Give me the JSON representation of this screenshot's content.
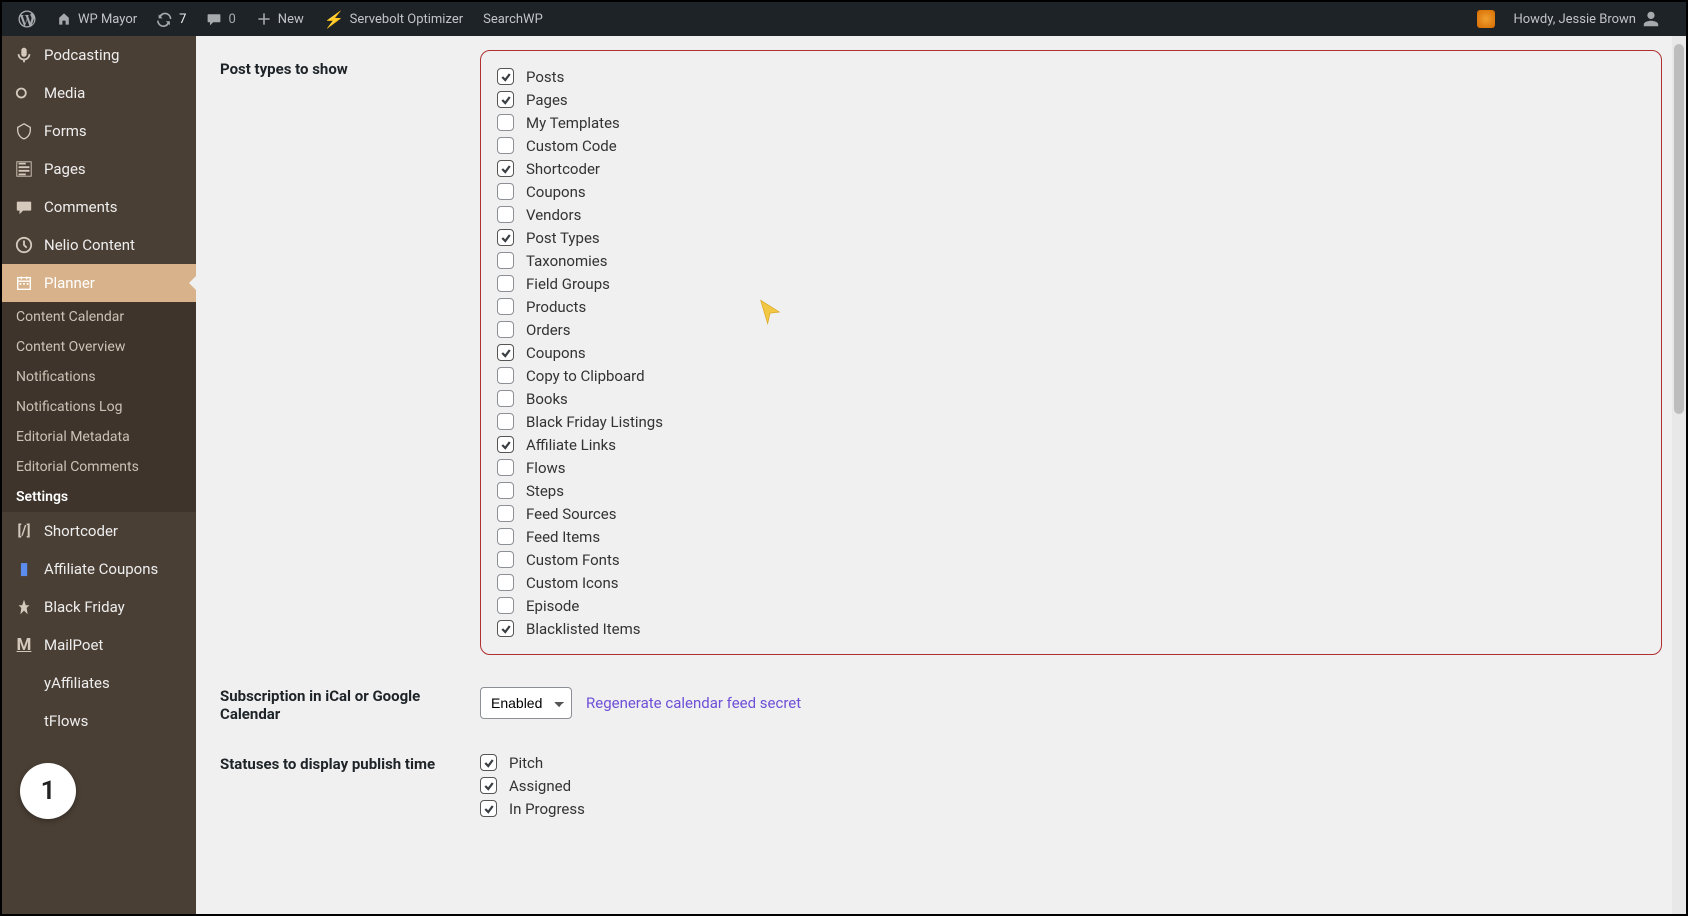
{
  "adminbar": {
    "site_name": "WP Mayor",
    "updates_count": "7",
    "comments_count": "0",
    "new_label": "New",
    "servebolt_label": "Servebolt Optimizer",
    "searchwp_label": "SearchWP",
    "howdy_text": "Howdy, Jessie Brown"
  },
  "sidebar": {
    "items": [
      {
        "label": "Podcasting",
        "icon": "mic"
      },
      {
        "label": "Media",
        "icon": "media"
      },
      {
        "label": "Forms",
        "icon": "forms"
      },
      {
        "label": "Pages",
        "icon": "pages"
      },
      {
        "label": "Comments",
        "icon": "comments"
      },
      {
        "label": "Nelio Content",
        "icon": "clock"
      },
      {
        "label": "Planner",
        "icon": "calendar",
        "active": true
      },
      {
        "label": "Shortcoder",
        "icon": "shortcoder"
      },
      {
        "label": "Affiliate Coupons",
        "icon": "coupon"
      },
      {
        "label": "Black Friday",
        "icon": "pin"
      },
      {
        "label": "MailPoet",
        "icon": "mailpoet"
      },
      {
        "label": "yAffiliates",
        "icon": "affiliates"
      },
      {
        "label": "tFlows",
        "icon": "flows"
      }
    ],
    "submenu": [
      {
        "label": "Content Calendar"
      },
      {
        "label": "Content Overview"
      },
      {
        "label": "Notifications"
      },
      {
        "label": "Notifications Log"
      },
      {
        "label": "Editorial Metadata"
      },
      {
        "label": "Editorial Comments"
      },
      {
        "label": "Settings",
        "bold": true
      }
    ]
  },
  "settings": {
    "post_types_label": "Post types to show",
    "post_types": [
      {
        "label": "Posts",
        "checked": true
      },
      {
        "label": "Pages",
        "checked": true
      },
      {
        "label": "My Templates",
        "checked": false
      },
      {
        "label": "Custom Code",
        "checked": false
      },
      {
        "label": "Shortcoder",
        "checked": true
      },
      {
        "label": "Coupons",
        "checked": false
      },
      {
        "label": "Vendors",
        "checked": false
      },
      {
        "label": "Post Types",
        "checked": true
      },
      {
        "label": "Taxonomies",
        "checked": false
      },
      {
        "label": "Field Groups",
        "checked": false
      },
      {
        "label": "Products",
        "checked": false
      },
      {
        "label": "Orders",
        "checked": false
      },
      {
        "label": "Coupons",
        "checked": true
      },
      {
        "label": "Copy to Clipboard",
        "checked": false
      },
      {
        "label": "Books",
        "checked": false
      },
      {
        "label": "Black Friday Listings",
        "checked": false
      },
      {
        "label": "Affiliate Links",
        "checked": true
      },
      {
        "label": "Flows",
        "checked": false
      },
      {
        "label": "Steps",
        "checked": false
      },
      {
        "label": "Feed Sources",
        "checked": false
      },
      {
        "label": "Feed Items",
        "checked": false
      },
      {
        "label": "Custom Fonts",
        "checked": false
      },
      {
        "label": "Custom Icons",
        "checked": false
      },
      {
        "label": "Episode",
        "checked": false
      },
      {
        "label": "Blacklisted Items",
        "checked": true
      }
    ],
    "subscription_label": "Subscription in iCal or Google Calendar",
    "subscription_select": "Enabled",
    "regenerate_link": "Regenerate calendar feed secret",
    "statuses_label": "Statuses to display publish time",
    "statuses": [
      {
        "label": "Pitch",
        "checked": true
      },
      {
        "label": "Assigned",
        "checked": true
      },
      {
        "label": "In Progress",
        "checked": true
      }
    ]
  },
  "step_badge": "1"
}
